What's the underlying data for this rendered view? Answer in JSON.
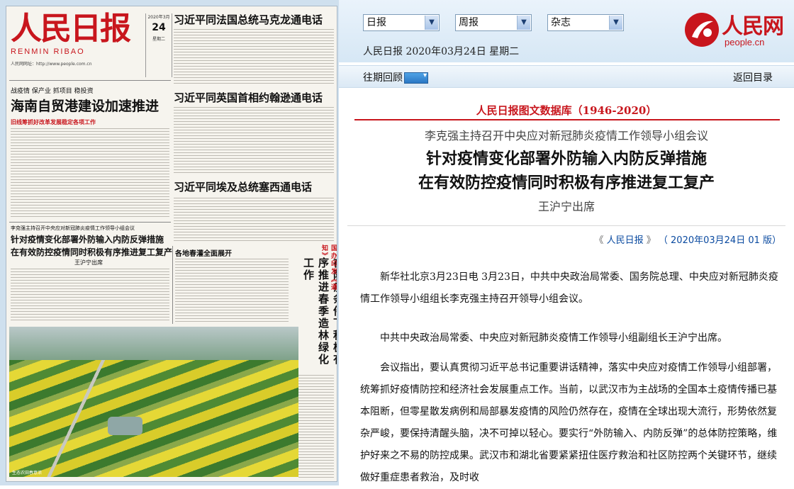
{
  "newspaper": {
    "masthead_title": "人民日报",
    "masthead_subtitle": "RENMIN RIBAO",
    "masthead_url": "人民网网址：http://www.people.com.cn",
    "date_label": "2020年3月",
    "date_day": "24",
    "date_weekday": "星期二",
    "headlines": {
      "h1": "习近平同法国总统马克龙通电话",
      "h2": "习近平同英国首相约翰逊通电话",
      "h3": "习近平同埃及总统塞西通电话",
      "left_kicker": "战疫情  保产业  抓项目  稳投资",
      "left_main": "海南自贸港建设加速推进",
      "left_deck": "旧线筹抓好改革发展稳定各项工作",
      "article_kicker": "李克强主持召开中央应对新冠肺炎疫情工作领导小组会议",
      "article_line1": "针对疫情变化部署外防输入内防反弹措施",
      "article_line2": "在有效防控疫情同时积极有序推进复工复产",
      "article_attend": "王沪宁出席",
      "spring": "各地春灌全面展开",
      "vertical_main": "在防疫条件下积极有序推进春季造林绿化工作",
      "vertical_side": "国办印发《通知》"
    },
    "photo_caption": "生态农田春意浓"
  },
  "topbar": {
    "select_daily": "日报",
    "select_weekly": "周报",
    "select_magazine": "杂志",
    "dateline": "人民日报 2020年03月24日 星期二",
    "logo_text": "人民网",
    "logo_url": "people.cn"
  },
  "navbar": {
    "past_issues": "往期回顾",
    "back_to_index": "返回目录"
  },
  "article": {
    "database_title": "人民日报图文数据库（1946-2020）",
    "kicker": "李克强主持召开中央应对新冠肺炎疫情工作领导小组会议",
    "title_line1": "针对疫情变化部署外防输入内防反弹措施",
    "title_line2": "在有效防控疫情同时积极有序推进复工复产",
    "attendee": "王沪宁出席",
    "source_open": "《",
    "source_paper": "人民日报",
    "source_close": "》",
    "source_date": "（ 2020年03月24日   01 版）",
    "paragraphs": [
      "新华社北京3月23日电 3月23日，中共中央政治局常委、国务院总理、中央应对新冠肺炎疫情工作领导小组组长李克强主持召开领导小组会议。",
      "中共中央政治局常委、中央应对新冠肺炎疫情工作领导小组副组长王沪宁出席。",
      "会议指出，要认真贯彻习近平总书记重要讲话精神，落实中央应对疫情工作领导小组部署，统筹抓好疫情防控和经济社会发展重点工作。当前，以武汉市为主战场的全国本土疫情传播已基本阻断，但零星散发病例和局部暴发疫情的风险仍然存在，疫情在全球出现大流行，形势依然复杂严峻，要保持清醒头脑，决不可掉以轻心。要实行“外防输入、内防反弹”的总体防控策略，维护好来之不易的防控成果。武汉市和湖北省要紧紧扭住医疗救治和社区防控两个关键环节，继续做好重症患者救治，及时收"
    ]
  }
}
